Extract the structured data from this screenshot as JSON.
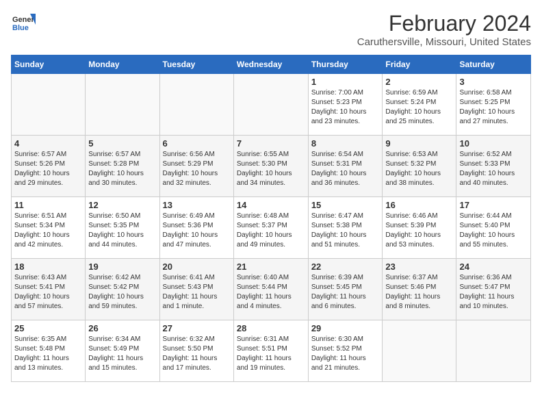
{
  "logo": {
    "general": "General",
    "blue": "Blue"
  },
  "title": "February 2024",
  "subtitle": "Caruthersville, Missouri, United States",
  "weekdays": [
    "Sunday",
    "Monday",
    "Tuesday",
    "Wednesday",
    "Thursday",
    "Friday",
    "Saturday"
  ],
  "weeks": [
    [
      {
        "day": "",
        "info": ""
      },
      {
        "day": "",
        "info": ""
      },
      {
        "day": "",
        "info": ""
      },
      {
        "day": "",
        "info": ""
      },
      {
        "day": "1",
        "info": "Sunrise: 7:00 AM\nSunset: 5:23 PM\nDaylight: 10 hours\nand 23 minutes."
      },
      {
        "day": "2",
        "info": "Sunrise: 6:59 AM\nSunset: 5:24 PM\nDaylight: 10 hours\nand 25 minutes."
      },
      {
        "day": "3",
        "info": "Sunrise: 6:58 AM\nSunset: 5:25 PM\nDaylight: 10 hours\nand 27 minutes."
      }
    ],
    [
      {
        "day": "4",
        "info": "Sunrise: 6:57 AM\nSunset: 5:26 PM\nDaylight: 10 hours\nand 29 minutes."
      },
      {
        "day": "5",
        "info": "Sunrise: 6:57 AM\nSunset: 5:28 PM\nDaylight: 10 hours\nand 30 minutes."
      },
      {
        "day": "6",
        "info": "Sunrise: 6:56 AM\nSunset: 5:29 PM\nDaylight: 10 hours\nand 32 minutes."
      },
      {
        "day": "7",
        "info": "Sunrise: 6:55 AM\nSunset: 5:30 PM\nDaylight: 10 hours\nand 34 minutes."
      },
      {
        "day": "8",
        "info": "Sunrise: 6:54 AM\nSunset: 5:31 PM\nDaylight: 10 hours\nand 36 minutes."
      },
      {
        "day": "9",
        "info": "Sunrise: 6:53 AM\nSunset: 5:32 PM\nDaylight: 10 hours\nand 38 minutes."
      },
      {
        "day": "10",
        "info": "Sunrise: 6:52 AM\nSunset: 5:33 PM\nDaylight: 10 hours\nand 40 minutes."
      }
    ],
    [
      {
        "day": "11",
        "info": "Sunrise: 6:51 AM\nSunset: 5:34 PM\nDaylight: 10 hours\nand 42 minutes."
      },
      {
        "day": "12",
        "info": "Sunrise: 6:50 AM\nSunset: 5:35 PM\nDaylight: 10 hours\nand 44 minutes."
      },
      {
        "day": "13",
        "info": "Sunrise: 6:49 AM\nSunset: 5:36 PM\nDaylight: 10 hours\nand 47 minutes."
      },
      {
        "day": "14",
        "info": "Sunrise: 6:48 AM\nSunset: 5:37 PM\nDaylight: 10 hours\nand 49 minutes."
      },
      {
        "day": "15",
        "info": "Sunrise: 6:47 AM\nSunset: 5:38 PM\nDaylight: 10 hours\nand 51 minutes."
      },
      {
        "day": "16",
        "info": "Sunrise: 6:46 AM\nSunset: 5:39 PM\nDaylight: 10 hours\nand 53 minutes."
      },
      {
        "day": "17",
        "info": "Sunrise: 6:44 AM\nSunset: 5:40 PM\nDaylight: 10 hours\nand 55 minutes."
      }
    ],
    [
      {
        "day": "18",
        "info": "Sunrise: 6:43 AM\nSunset: 5:41 PM\nDaylight: 10 hours\nand 57 minutes."
      },
      {
        "day": "19",
        "info": "Sunrise: 6:42 AM\nSunset: 5:42 PM\nDaylight: 10 hours\nand 59 minutes."
      },
      {
        "day": "20",
        "info": "Sunrise: 6:41 AM\nSunset: 5:43 PM\nDaylight: 11 hours\nand 1 minute."
      },
      {
        "day": "21",
        "info": "Sunrise: 6:40 AM\nSunset: 5:44 PM\nDaylight: 11 hours\nand 4 minutes."
      },
      {
        "day": "22",
        "info": "Sunrise: 6:39 AM\nSunset: 5:45 PM\nDaylight: 11 hours\nand 6 minutes."
      },
      {
        "day": "23",
        "info": "Sunrise: 6:37 AM\nSunset: 5:46 PM\nDaylight: 11 hours\nand 8 minutes."
      },
      {
        "day": "24",
        "info": "Sunrise: 6:36 AM\nSunset: 5:47 PM\nDaylight: 11 hours\nand 10 minutes."
      }
    ],
    [
      {
        "day": "25",
        "info": "Sunrise: 6:35 AM\nSunset: 5:48 PM\nDaylight: 11 hours\nand 13 minutes."
      },
      {
        "day": "26",
        "info": "Sunrise: 6:34 AM\nSunset: 5:49 PM\nDaylight: 11 hours\nand 15 minutes."
      },
      {
        "day": "27",
        "info": "Sunrise: 6:32 AM\nSunset: 5:50 PM\nDaylight: 11 hours\nand 17 minutes."
      },
      {
        "day": "28",
        "info": "Sunrise: 6:31 AM\nSunset: 5:51 PM\nDaylight: 11 hours\nand 19 minutes."
      },
      {
        "day": "29",
        "info": "Sunrise: 6:30 AM\nSunset: 5:52 PM\nDaylight: 11 hours\nand 21 minutes."
      },
      {
        "day": "",
        "info": ""
      },
      {
        "day": "",
        "info": ""
      }
    ]
  ]
}
